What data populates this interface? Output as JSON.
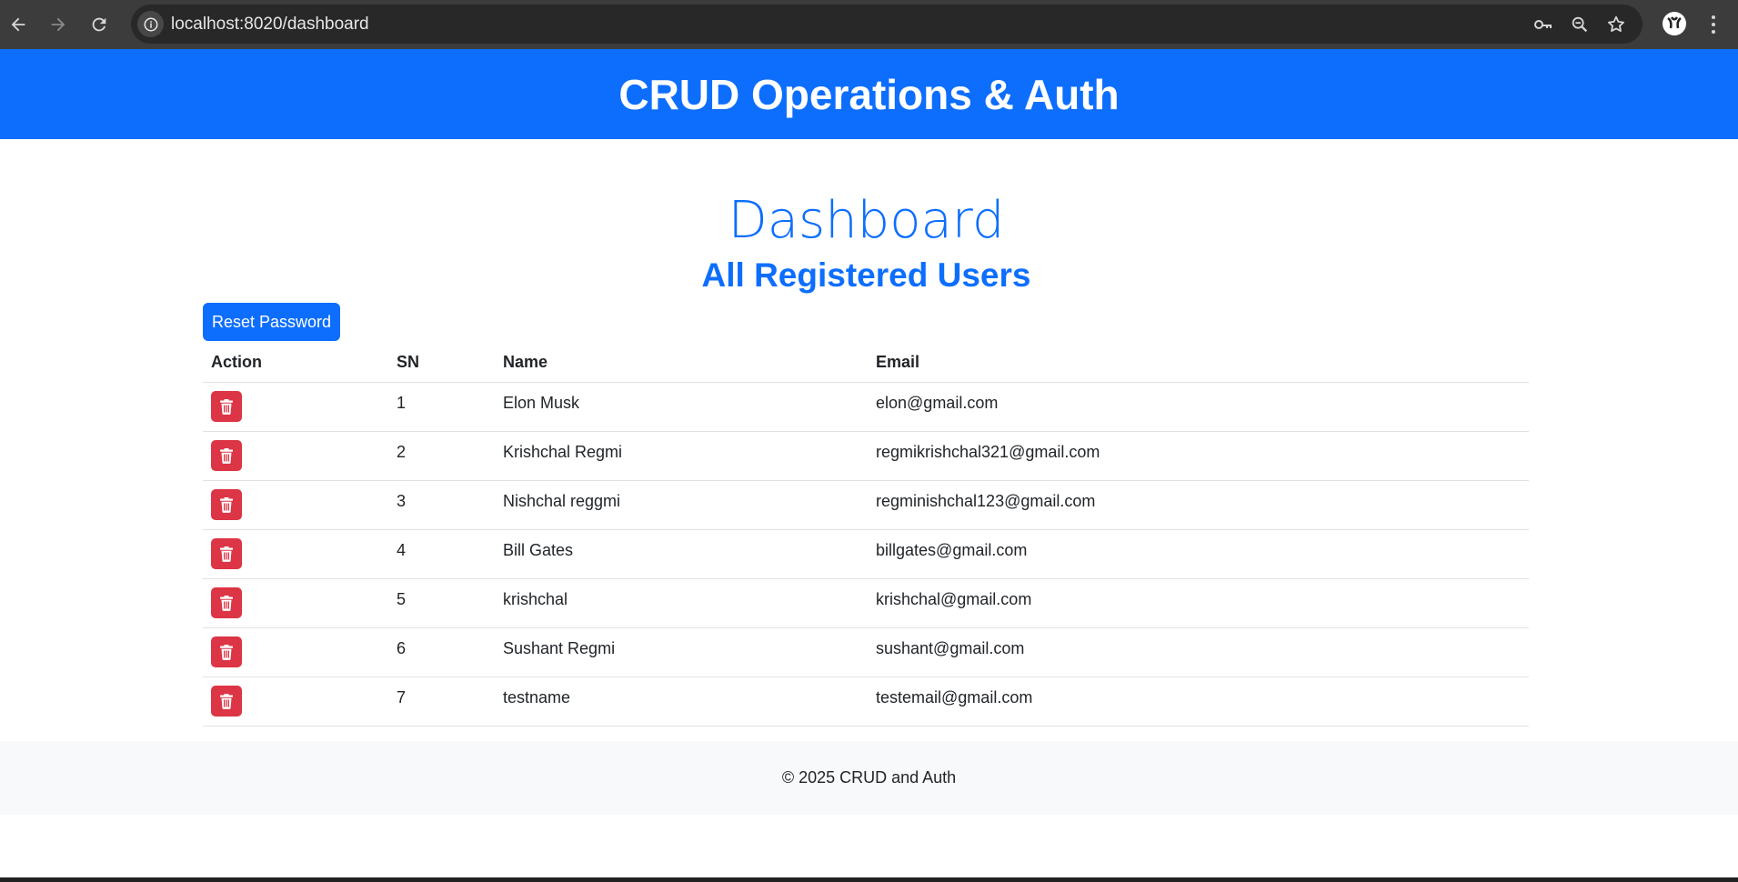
{
  "browser": {
    "url": "localhost:8020/dashboard"
  },
  "header": {
    "title": "CRUD Operations & Auth"
  },
  "main": {
    "title": "Dashboard",
    "subtitle": "All Registered Users",
    "reset_button_label": "Reset Password"
  },
  "table": {
    "columns": [
      "Action",
      "SN",
      "Name",
      "Email"
    ],
    "rows": [
      {
        "sn": "1",
        "name": "Elon Musk",
        "email": "elon@gmail.com"
      },
      {
        "sn": "2",
        "name": "Krishchal Regmi",
        "email": "regmikrishchal321@gmail.com"
      },
      {
        "sn": "3",
        "name": "Nishchal reggmi",
        "email": "regminishchal123@gmail.com"
      },
      {
        "sn": "4",
        "name": "Bill Gates",
        "email": "billgates@gmail.com"
      },
      {
        "sn": "5",
        "name": "krishchal",
        "email": "krishchal@gmail.com"
      },
      {
        "sn": "6",
        "name": "Sushant Regmi",
        "email": "sushant@gmail.com"
      },
      {
        "sn": "7",
        "name": "testname",
        "email": "testemail@gmail.com"
      }
    ],
    "row_action_icon": "trash-icon"
  },
  "footer": {
    "text": "© 2025 CRUD and Auth"
  },
  "colors": {
    "primary": "#0d6efd",
    "danger": "#dc3545",
    "footer_bg": "#f8f9fa",
    "chrome_bg": "#3c3c3c"
  }
}
